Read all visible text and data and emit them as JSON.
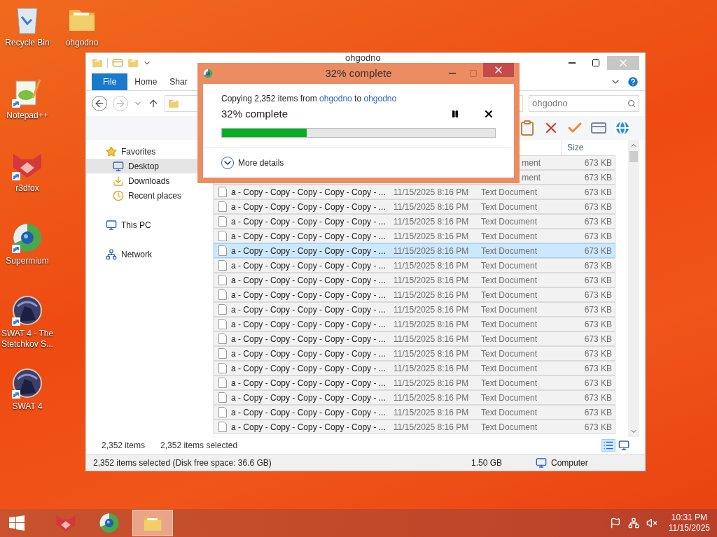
{
  "desktop_columns": [
    {
      "icons": [
        {
          "label": "Recycle Bin",
          "kind": "recycle",
          "shortcut": false
        },
        {
          "label": "Notepad++",
          "kind": "notepad",
          "shortcut": true
        },
        {
          "label": "r3dfox",
          "kind": "fox",
          "shortcut": true
        },
        {
          "label": "Supermium",
          "kind": "browser",
          "shortcut": true
        },
        {
          "label": "SWAT 4 - The Stetchkov S...",
          "kind": "game",
          "shortcut": true
        },
        {
          "label": "SWAT 4",
          "kind": "game",
          "shortcut": true
        }
      ]
    },
    {
      "icons": [
        {
          "label": "ohgodno",
          "kind": "folder",
          "shortcut": false
        }
      ]
    }
  ],
  "explorer": {
    "title": "ohgodno",
    "ribbon_tabs": [
      {
        "label": "File",
        "selected": true
      },
      {
        "label": "Home",
        "selected": false
      },
      {
        "label": "Shar",
        "selected": false
      }
    ],
    "search": {
      "placeholder": "ohgodno"
    },
    "nav": [
      {
        "label": "Favorites",
        "kind": "favorites",
        "selected": false
      },
      {
        "label": "Desktop",
        "kind": "desktop",
        "selected": true
      },
      {
        "label": "Downloads",
        "kind": "downloads",
        "selected": false
      },
      {
        "label": "Recent places",
        "kind": "recent",
        "selected": false
      },
      {
        "label": "This PC",
        "kind": "pc",
        "selected": false
      },
      {
        "label": "Network",
        "kind": "network",
        "selected": false
      }
    ],
    "columns": [
      "Size"
    ],
    "rows": [
      {
        "kind": "partial",
        "type": "ment",
        "size": "673 KB",
        "selected": true,
        "focused": false
      },
      {
        "kind": "partial",
        "type": "ment",
        "size": "673 KB",
        "selected": true,
        "focused": false
      },
      {
        "kind": "full",
        "name": "a - Copy - Copy - Copy - Copy - Copy - ...",
        "date": "11/15/2025 8:16 PM",
        "type": "Text Document",
        "size": "673 KB",
        "selected": true,
        "focused": false
      },
      {
        "kind": "full",
        "name": "a - Copy - Copy - Copy - Copy - Copy - ...",
        "date": "11/15/2025 8:16 PM",
        "type": "Text Document",
        "size": "673 KB",
        "selected": true,
        "focused": false
      },
      {
        "kind": "full",
        "name": "a - Copy - Copy - Copy - Copy - Copy - ...",
        "date": "11/15/2025 8:16 PM",
        "type": "Text Document",
        "size": "673 KB",
        "selected": true,
        "focused": false
      },
      {
        "kind": "full",
        "name": "a - Copy - Copy - Copy - Copy - Copy - ...",
        "date": "11/15/2025 8:16 PM",
        "type": "Text Document",
        "size": "673 KB",
        "selected": true,
        "focused": false
      },
      {
        "kind": "full",
        "name": "a - Copy - Copy - Copy - Copy - Copy - ...",
        "date": "11/15/2025 8:16 PM",
        "type": "Text Document",
        "size": "673 KB",
        "selected": true,
        "focused": true
      },
      {
        "kind": "full",
        "name": "a - Copy - Copy - Copy - Copy - Copy - ...",
        "date": "11/15/2025 8:16 PM",
        "type": "Text Document",
        "size": "673 KB",
        "selected": true,
        "focused": false
      },
      {
        "kind": "full",
        "name": "a - Copy - Copy - Copy - Copy - Copy - ...",
        "date": "11/15/2025 8:16 PM",
        "type": "Text Document",
        "size": "673 KB",
        "selected": true,
        "focused": false
      },
      {
        "kind": "full",
        "name": "a - Copy - Copy - Copy - Copy - Copy - ...",
        "date": "11/15/2025 8:16 PM",
        "type": "Text Document",
        "size": "673 KB",
        "selected": true,
        "focused": false
      },
      {
        "kind": "full",
        "name": "a - Copy - Copy - Copy - Copy - Copy - ...",
        "date": "11/15/2025 8:16 PM",
        "type": "Text Document",
        "size": "673 KB",
        "selected": true,
        "focused": false
      },
      {
        "kind": "full",
        "name": "a - Copy - Copy - Copy - Copy - Copy - ...",
        "date": "11/15/2025 8:16 PM",
        "type": "Text Document",
        "size": "673 KB",
        "selected": true,
        "focused": false
      },
      {
        "kind": "full",
        "name": "a - Copy - Copy - Copy - Copy - Copy - ...",
        "date": "11/15/2025 8:16 PM",
        "type": "Text Document",
        "size": "673 KB",
        "selected": true,
        "focused": false
      },
      {
        "kind": "full",
        "name": "a - Copy - Copy - Copy - Copy - Copy - ...",
        "date": "11/15/2025 8:16 PM",
        "type": "Text Document",
        "size": "673 KB",
        "selected": true,
        "focused": false
      },
      {
        "kind": "full",
        "name": "a - Copy - Copy - Copy - Copy - Copy - ...",
        "date": "11/15/2025 8:16 PM",
        "type": "Text Document",
        "size": "673 KB",
        "selected": true,
        "focused": false
      },
      {
        "kind": "full",
        "name": "a - Copy - Copy - Copy - Copy - Copy - ...",
        "date": "11/15/2025 8:16 PM",
        "type": "Text Document",
        "size": "673 KB",
        "selected": true,
        "focused": false
      },
      {
        "kind": "full",
        "name": "a - Copy - Copy - Copy - Copy - Copy - ...",
        "date": "11/15/2025 8:16 PM",
        "type": "Text Document",
        "size": "673 KB",
        "selected": true,
        "focused": false
      },
      {
        "kind": "full",
        "name": "a - Copy - Copy - Copy - Copy - Copy - ...",
        "date": "11/15/2025 8:16 PM",
        "type": "Text Document",
        "size": "673 KB",
        "selected": true,
        "focused": false
      },
      {
        "kind": "full",
        "name": "a - Copy - Copy - Copy - Copy - Copy - ...",
        "date": "11/15/2025 8:16 PM",
        "type": "Text Document",
        "size": "673 KB",
        "selected": true,
        "focused": false
      }
    ],
    "item_count": "2,352 items",
    "selected_count": "2,352 items selected",
    "status_bar": {
      "text": "2,352 items selected (Disk free space: 36.6 GB)",
      "size": "1.50 GB",
      "location": "Computer"
    }
  },
  "copy_dialog": {
    "title": "32% complete",
    "message": [
      {
        "kind": "text",
        "text": "Copying 2,352 items from "
      },
      {
        "kind": "link",
        "text": "ohgodno"
      },
      {
        "kind": "text",
        "text": " to "
      },
      {
        "kind": "link",
        "text": "ohgodno"
      }
    ],
    "progress_text": "32% complete",
    "level": 0.31,
    "details": "More details"
  },
  "taskbar": {
    "apps": [
      {
        "kind": "fox",
        "active": false
      },
      {
        "kind": "browser",
        "active": false
      },
      {
        "kind": "folder",
        "active": true
      }
    ],
    "time": "10:31 PM",
    "date": "11/15/2025"
  }
}
